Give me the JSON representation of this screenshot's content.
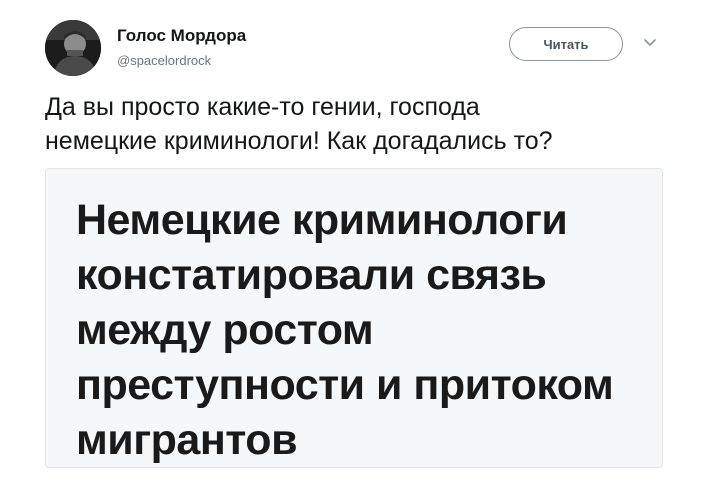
{
  "author": {
    "name": "Голос Мордора",
    "handle": "@spacelordrock"
  },
  "follow_button": {
    "label": "Читать"
  },
  "tweet": {
    "text_line1": "Да вы просто какие-то гении, господа",
    "text_line2": "немецкие криминологи! Как догадались то?"
  },
  "media": {
    "headline_lines": [
      "Немецкие криминологи",
      "констатировали связь",
      "между ростом",
      "преступности и притоком",
      "мигрантов"
    ]
  },
  "icons": {
    "avatar": "user-avatar",
    "caret": "chevron-down-icon"
  },
  "colors": {
    "text_primary": "#14171a",
    "text_secondary": "#657786",
    "button_border": "#8a949c",
    "card_border": "#e1e8ed",
    "card_background": "#f5f8fa"
  }
}
